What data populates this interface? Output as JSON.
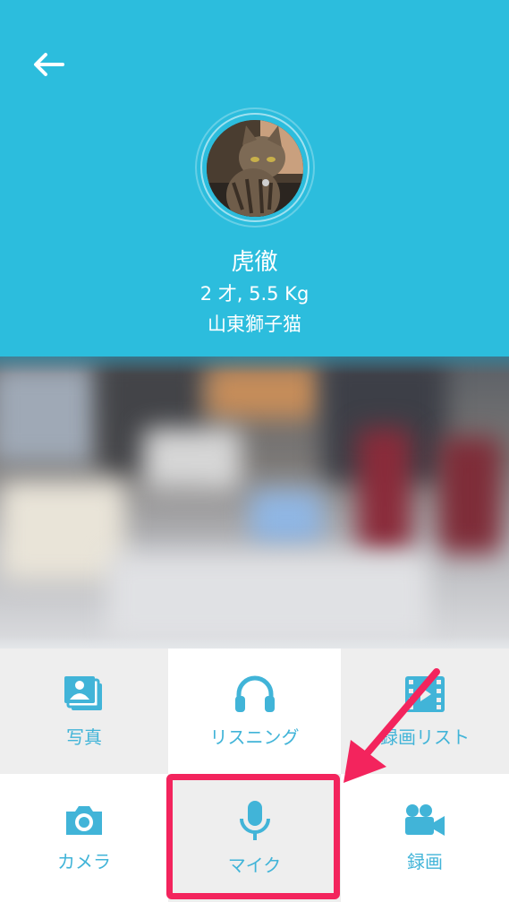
{
  "header": {
    "back_icon": "arrow-left-icon",
    "pet_name": "虎徹",
    "pet_info": "2 才, 5.5 Kg",
    "pet_breed": "山東獅子猫",
    "bg_color": "#2cbddd"
  },
  "controls": {
    "row1": [
      {
        "label": "写真",
        "icon": "photos-icon"
      },
      {
        "label": "リスニング",
        "icon": "headphones-icon"
      },
      {
        "label": "録画リスト",
        "icon": "film-icon"
      }
    ],
    "row2": [
      {
        "label": "カメラ",
        "icon": "camera-icon"
      },
      {
        "label": "マイク",
        "icon": "microphone-icon"
      },
      {
        "label": "録画",
        "icon": "video-camera-icon"
      }
    ],
    "accent_color": "#41b4d8"
  },
  "annotation": {
    "highlight_color": "#f3245d"
  }
}
